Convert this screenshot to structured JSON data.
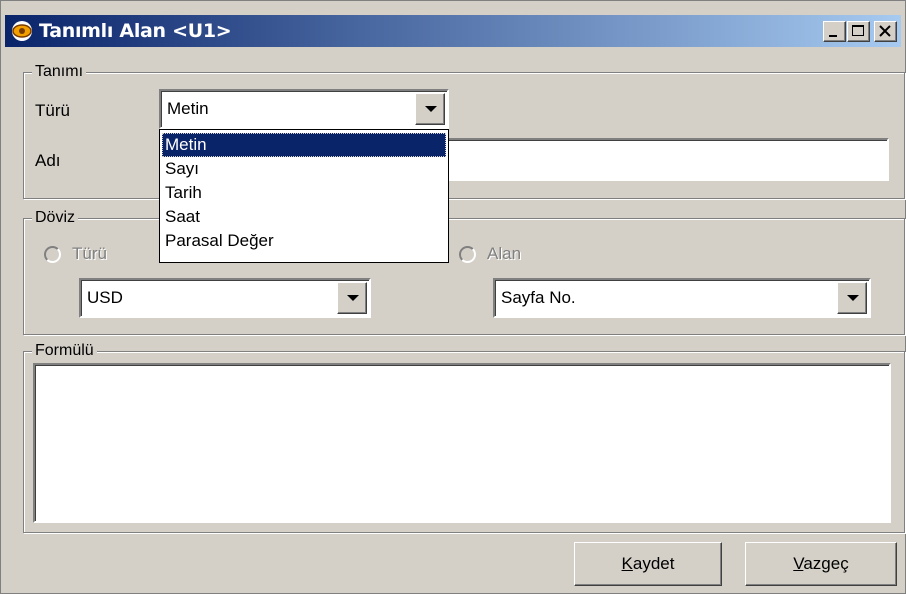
{
  "window": {
    "title": "Tanımlı Alan <U1>"
  },
  "tanimi": {
    "legend": "Tanımı",
    "turu_label": "Türü",
    "turu_value": "Metin",
    "adi_label": "Adı",
    "adi_value": "",
    "dropdown_options": [
      "Metin",
      "Sayı",
      "Tarih",
      "Saat",
      "Parasal Değer"
    ],
    "dropdown_selected": "Metin"
  },
  "doviz": {
    "legend": "Döviz",
    "radio_turu_label": "Türü",
    "radio_alan_label": "Alan",
    "currency_value": "USD",
    "field_value": "Sayfa No."
  },
  "formulu": {
    "legend": "Formülü",
    "value": ""
  },
  "buttons": {
    "save_accel": "K",
    "save_rest": "aydet",
    "cancel_accel": "V",
    "cancel_rest": "azgeç"
  },
  "colors": {
    "titlebar_start": "#0a246a",
    "titlebar_end": "#a6caf0",
    "selection": "#0a246a",
    "face": "#d4d0c8"
  }
}
